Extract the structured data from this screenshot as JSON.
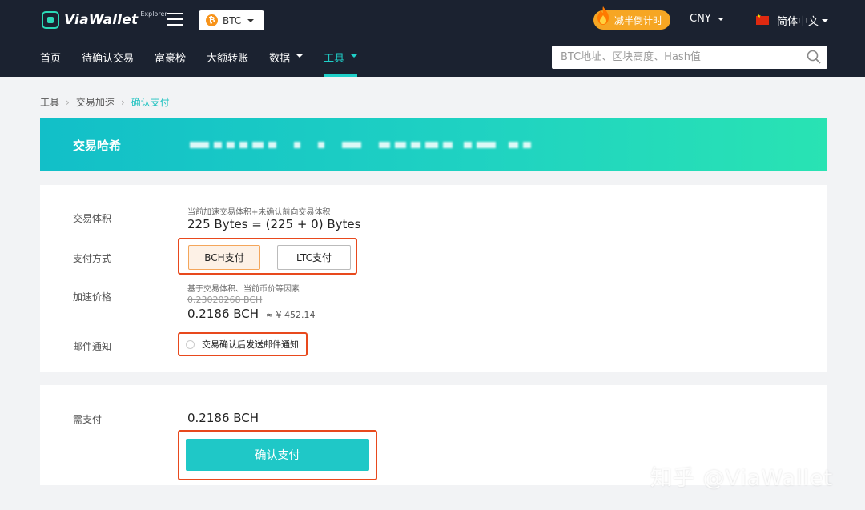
{
  "header": {
    "logo_text": "ViaWallet",
    "logo_sub": "Explorer",
    "coin": "BTC",
    "halving_label": "减半倒计时",
    "currency": "CNY",
    "language": "简体中文"
  },
  "nav": {
    "items": [
      "首页",
      "待确认交易",
      "富豪榜",
      "大额转账",
      "数据",
      "工具"
    ],
    "active": "工具"
  },
  "search": {
    "placeholder": "BTC地址、区块高度、Hash值"
  },
  "breadcrumb": [
    "工具",
    "交易加速",
    "确认支付"
  ],
  "banner": {
    "label": "交易哈希"
  },
  "form": {
    "size_label": "交易体积",
    "size_hint": "当前加速交易体积+未确认前向交易体积",
    "size_value": "225 Bytes = (225 + 0) Bytes",
    "pay_method_label": "支付方式",
    "pay_bch": "BCH支付",
    "pay_ltc": "LTC支付",
    "price_label": "加速价格",
    "price_hint": "基于交易体积、当前币价等因素",
    "price_original": "0.23020268 BCH",
    "price_value": "0.2186 BCH",
    "price_fiat": "≈ ¥ 452.14",
    "mail_label": "邮件通知",
    "mail_option": "交易确认后发送邮件通知"
  },
  "payment": {
    "due_label": "需支付",
    "due_value": "0.2186 BCH",
    "confirm_button": "确认支付"
  },
  "watermark": "知乎 @ViaWallet",
  "colors": {
    "header_bg": "#1b2230",
    "accent": "#1fc8c7",
    "highlight_border": "#e8491d",
    "halving": "#f6a623"
  }
}
